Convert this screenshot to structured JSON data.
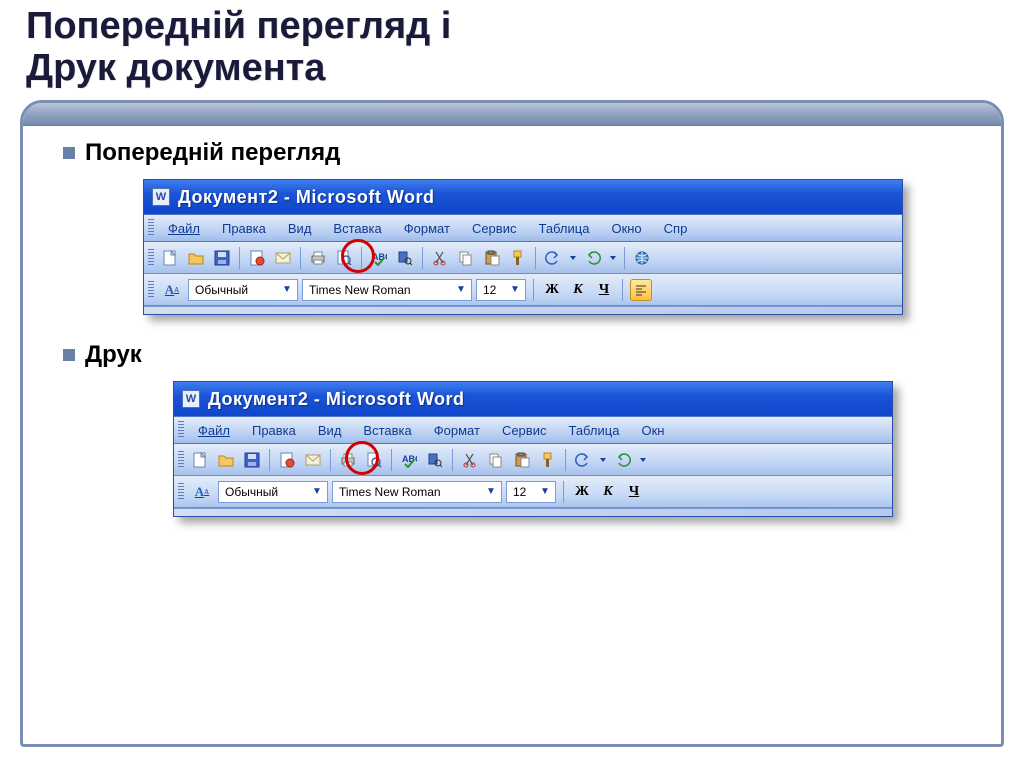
{
  "slide": {
    "title_line1": "Попередній перегляд і",
    "title_line2": "Друк документа",
    "bullet_preview": "Попередній перегляд",
    "bullet_print": "Друк"
  },
  "word": {
    "app_icon_letter": "W",
    "title": "Документ2 - Microsoft Word",
    "menus_a": [
      "Файл",
      "Правка",
      "Вид",
      "Вставка",
      "Формат",
      "Сервис",
      "Таблица",
      "Окно",
      "Спр"
    ],
    "menus_b": [
      "Файл",
      "Правка",
      "Вид",
      "Вставка",
      "Формат",
      "Сервис",
      "Таблица",
      "Окн"
    ],
    "format": {
      "style_icon": "A̲ᴀ",
      "style_value": "Обычный",
      "font_value": "Times New Roman",
      "size_value": "12",
      "bold": "Ж",
      "italic": "К",
      "underline": "Ч"
    },
    "icons": {
      "new": "new-doc-icon",
      "open": "open-folder-icon",
      "save": "save-disk-icon",
      "permission": "permission-icon",
      "mail": "mail-icon",
      "print": "print-icon",
      "preview": "print-preview-icon",
      "spelling": "spelling-icon",
      "research": "research-icon",
      "cut": "cut-icon",
      "copy": "copy-icon",
      "paste": "paste-icon",
      "format_painter": "format-painter-icon",
      "undo": "undo-icon",
      "redo": "redo-icon",
      "hyperlink": "hyperlink-icon",
      "align_left": "align-left-icon"
    }
  }
}
